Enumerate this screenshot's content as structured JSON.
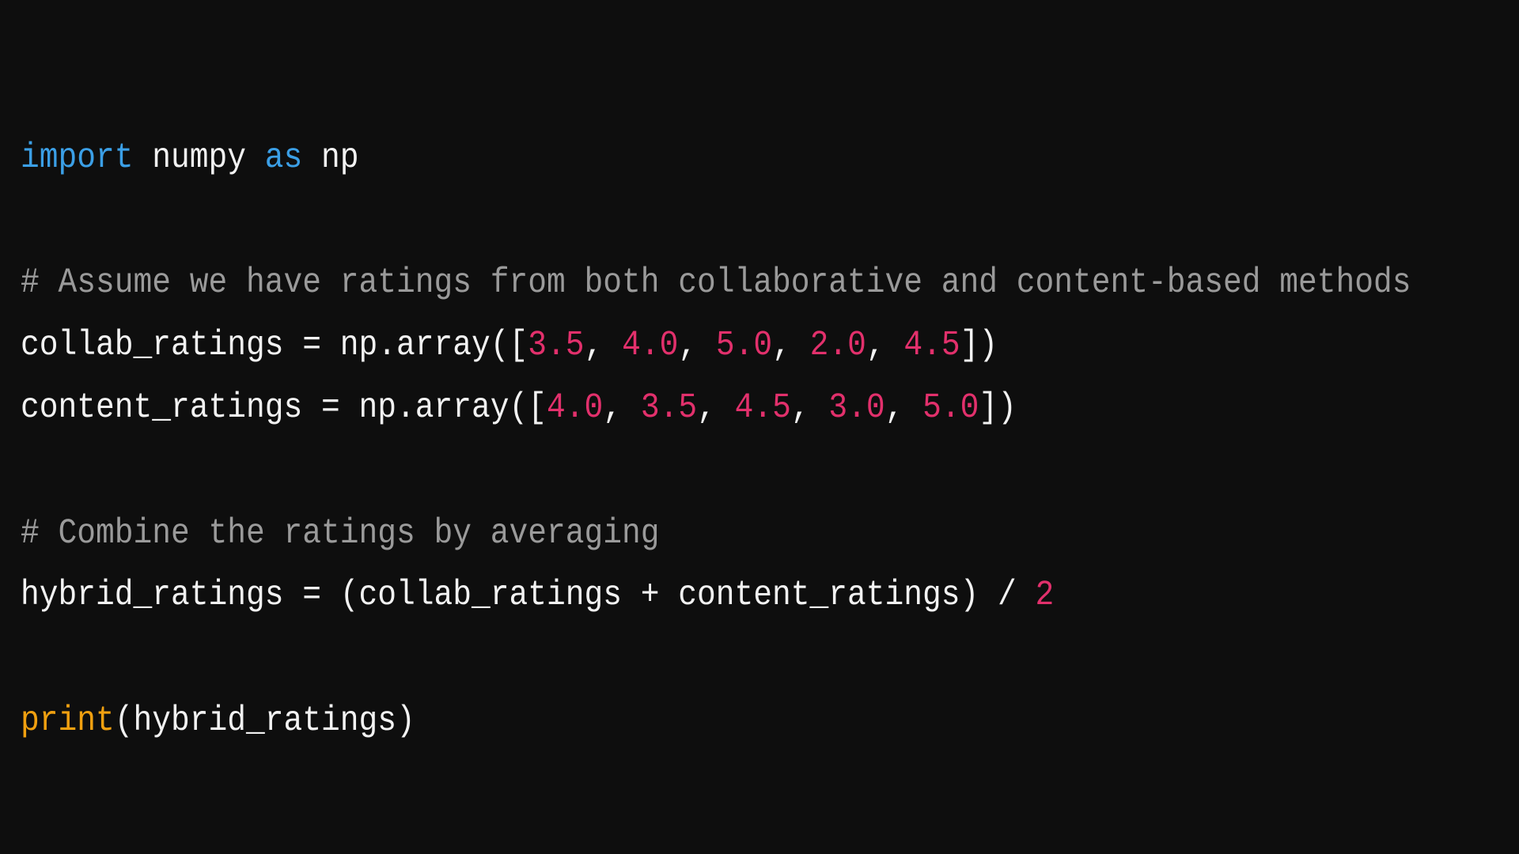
{
  "editor": {
    "background": "#0e0e0e",
    "colors": {
      "keyword": "#3b9fe6",
      "comment": "#9a9a9a",
      "number": "#e2306c",
      "builtin": "#f0a010",
      "text": "#f2f2f2"
    },
    "lines": {
      "import": {
        "kw_import": "import",
        "module": " numpy ",
        "kw_as": "as",
        "alias": " np"
      },
      "comment1": "# Assume we have ratings from both collaborative and content-based methods",
      "collab": {
        "prefix": "collab_ratings = np.array([",
        "values": [
          "3.5",
          "4.0",
          "5.0",
          "2.0",
          "4.5"
        ],
        "sep": ", ",
        "suffix": "])"
      },
      "content": {
        "prefix": "content_ratings = np.array([",
        "values": [
          "4.0",
          "3.5",
          "4.5",
          "3.0",
          "5.0"
        ],
        "sep": ", ",
        "suffix": "])"
      },
      "comment2": "# Combine the ratings by averaging",
      "hybrid": {
        "prefix": "hybrid_ratings = (collab_ratings + content_ratings) / ",
        "divisor": "2"
      },
      "print": {
        "fn": "print",
        "args": "(hybrid_ratings)"
      }
    }
  }
}
